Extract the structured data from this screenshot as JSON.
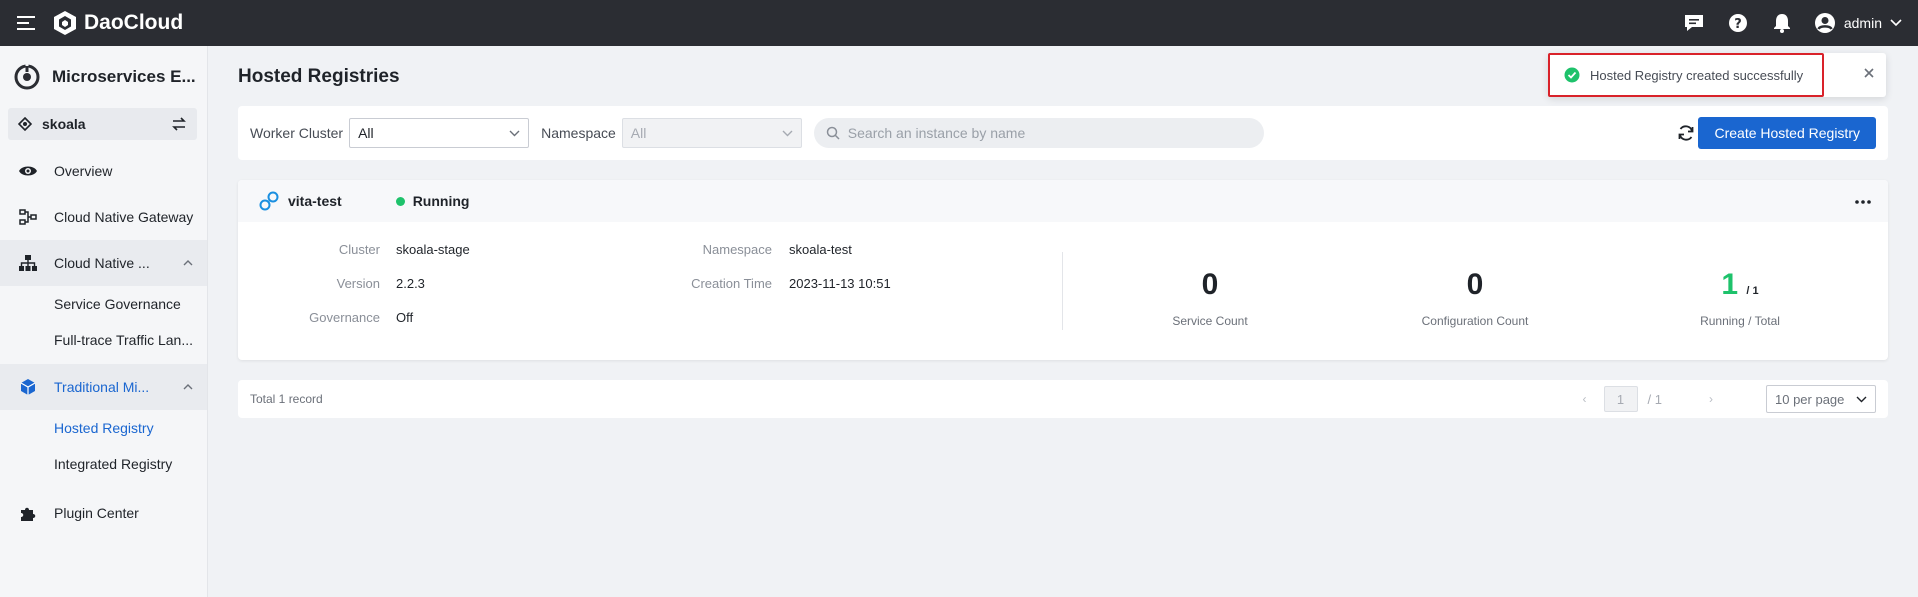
{
  "topbar": {
    "brand": "DaoCloud",
    "user_name": "admin",
    "icons": [
      "menu-icon",
      "message-icon",
      "help-icon",
      "bell-icon",
      "user-avatar-icon",
      "chevron-down-icon"
    ]
  },
  "sidebar": {
    "workspace_title": "Microservices E...",
    "namespace": "skoala",
    "items": [
      {
        "label": "Overview",
        "icon": "eye-icon"
      },
      {
        "label": "Cloud Native Gateway",
        "icon": "gateway-icon"
      },
      {
        "label": "Cloud Native ...",
        "icon": "hierarchy-icon",
        "expanded": true,
        "children": [
          {
            "label": "Service Governance"
          },
          {
            "label": "Full-trace Traffic Lan..."
          }
        ]
      },
      {
        "label": "Traditional Mi...",
        "icon": "cube-icon",
        "expanded": true,
        "active": true,
        "children": [
          {
            "label": "Hosted Registry",
            "active": true
          },
          {
            "label": "Integrated Registry"
          }
        ]
      },
      {
        "label": "Plugin Center",
        "icon": "puzzle-icon"
      }
    ]
  },
  "main": {
    "title": "Hosted Registries",
    "filters": {
      "cluster_label": "Worker Cluster",
      "cluster_value": "All",
      "namespace_label": "Namespace",
      "namespace_value": "All",
      "search_placeholder": "Search an instance by name"
    },
    "create_button": "Create Hosted Registry",
    "card": {
      "name": "vita-test",
      "status": "Running",
      "status_color": "#1ec26b",
      "fields_left": [
        {
          "key": "Cluster",
          "value": "skoala-stage"
        },
        {
          "key": "Version",
          "value": "2.2.3"
        },
        {
          "key": "Governance",
          "value": "Off"
        }
      ],
      "fields_mid": [
        {
          "key": "Namespace",
          "value": "skoala-test"
        },
        {
          "key": "Creation Time",
          "value": "2023-11-13 10:51"
        }
      ],
      "stats": {
        "service_count": "0",
        "service_count_label": "Service Count",
        "config_count": "0",
        "config_count_label": "Configuration Count",
        "running": "1",
        "total": "/ 1",
        "running_label": "Running / Total"
      }
    },
    "pagination": {
      "total_text": "Total 1 record",
      "current_page": "1",
      "page_total": "/ 1",
      "per_page": "10 per page"
    }
  },
  "toast": {
    "message": "Hosted Registry created successfully",
    "type": "success"
  },
  "colors": {
    "primary": "#1a66d0",
    "success": "#1ec26b",
    "topbar": "#2b2d33",
    "highlight": "#d9222a"
  }
}
